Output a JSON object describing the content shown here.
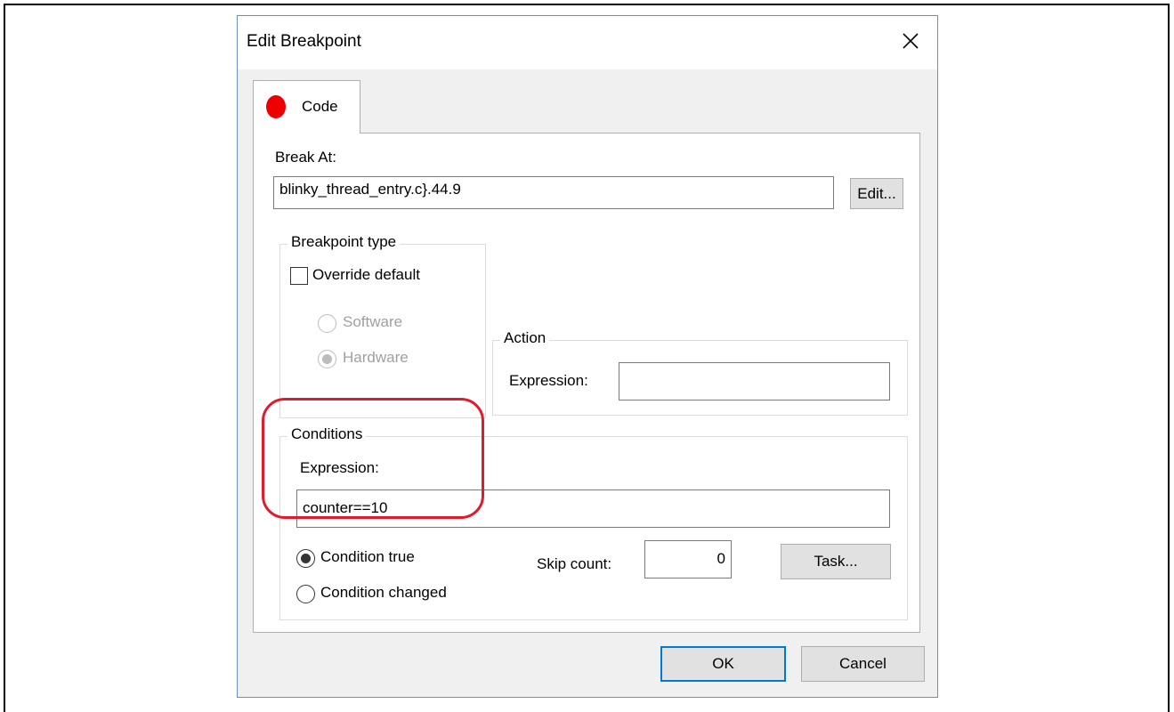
{
  "dialog": {
    "title": "Edit Breakpoint",
    "close_icon": "close-icon",
    "tab": {
      "label": "Code",
      "icon": "breakpoint-dot-icon",
      "icon_color": "#ee0000"
    },
    "break_at": {
      "label": "Break At:",
      "value": "blinky_thread_entry.c}.44.9",
      "edit_button": "Edit..."
    },
    "breakpoint_type": {
      "legend": "Breakpoint type",
      "override_label": "Override default",
      "override_checked": false,
      "software_label": "Software",
      "hardware_label": "Hardware",
      "selected": "Hardware"
    },
    "action": {
      "legend": "Action",
      "expression_label": "Expression:",
      "expression_value": ""
    },
    "conditions": {
      "legend": "Conditions",
      "expression_label": "Expression:",
      "expression_value": "counter==10",
      "condition_true_label": "Condition true",
      "condition_changed_label": "Condition changed",
      "selected": "Condition true",
      "skip_count_label": "Skip count:",
      "skip_count_value": "0",
      "task_button": "Task..."
    },
    "ok_button": "OK",
    "cancel_button": "Cancel",
    "highlight_color": "#e01c2c"
  }
}
